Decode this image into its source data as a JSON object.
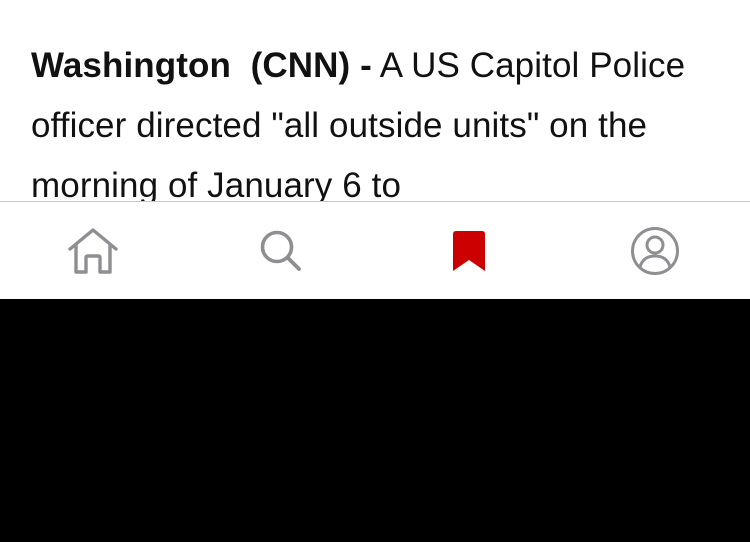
{
  "article": {
    "dateline_location": "Washington",
    "dateline_source": "(CNN)",
    "dateline_separator": "-",
    "body_text": "A US Capitol Police officer directed \"all outside units\" on the morning of January 6 to"
  },
  "tab_bar": {
    "tabs": [
      {
        "icon": "home-icon",
        "active": false,
        "color": "#8e8e93"
      },
      {
        "icon": "search-icon",
        "active": false,
        "color": "#8e8e93"
      },
      {
        "icon": "bookmark-icon",
        "active": true,
        "color": "#cc0000"
      },
      {
        "icon": "account-icon",
        "active": false,
        "color": "#8e8e93"
      }
    ]
  },
  "colors": {
    "accent": "#cc0000",
    "icon_inactive": "#8e8e93",
    "text": "#111111",
    "background": "#ffffff"
  }
}
